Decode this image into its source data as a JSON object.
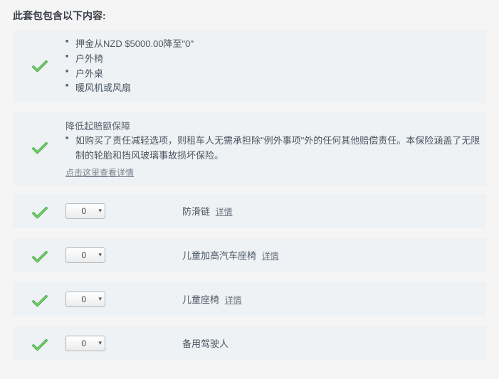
{
  "title": "此套包包含以下内容:",
  "includes": {
    "items": [
      "押金从NZD $5000.00降至\"0\"",
      "户外椅",
      "户外桌",
      "暖风机或风扇"
    ]
  },
  "insurance": {
    "heading": "降低起赔额保障",
    "body": "如购买了责任减轻选项，则租车人无需承担除\"例外事项\"外的任何其他赔偿责任。本保险涵盖了无限制的轮胎和挡风玻璃事故损坏保险。",
    "link": "点击这里查看详情"
  },
  "options": [
    {
      "qty": "0",
      "label": "防滑链",
      "detail": "详情"
    },
    {
      "qty": "0",
      "label": "儿童加高汽车座椅",
      "detail": "详情"
    },
    {
      "qty": "0",
      "label": "儿童座椅",
      "detail": "详情"
    },
    {
      "qty": "0",
      "label": "备用驾驶人",
      "detail": ""
    }
  ]
}
